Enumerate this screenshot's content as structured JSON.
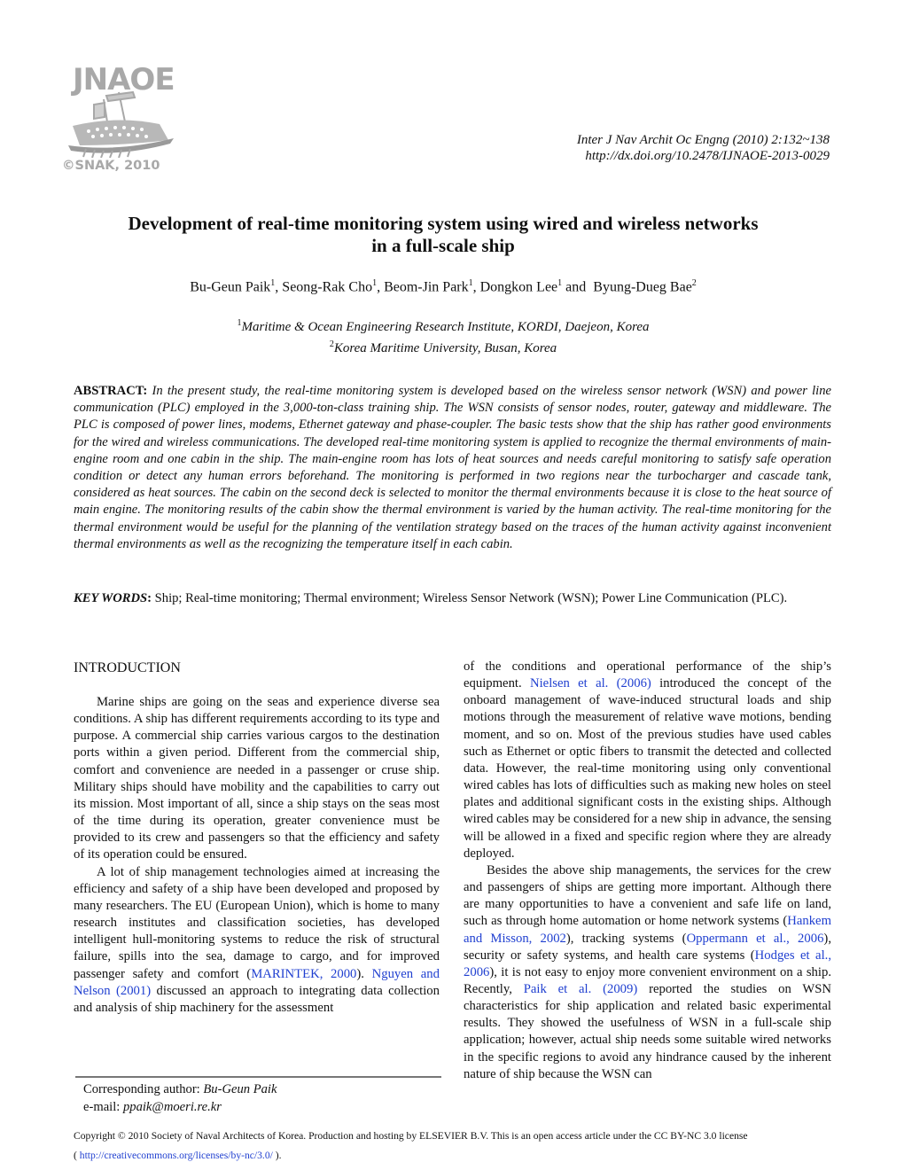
{
  "logo": {
    "name": "JNAOE",
    "copyright": "©SNAK, 2010",
    "icon": "ship-logo-icon"
  },
  "journal_ref": {
    "citation": "Inter J Nav Archit Oc Engng (2010) 2:132~138",
    "doi": "http://dx.doi.org/10.2478/IJNAOE-2013-0029"
  },
  "paper": {
    "title_line1": "Development of real-time monitoring system using wired and wireless networks",
    "title_line2": "in a full-scale ship",
    "authors": [
      {
        "name": "Bu-Geun Paik",
        "aff": "1",
        "sep": ", "
      },
      {
        "name": "Seong-Rak Cho",
        "aff": "1",
        "sep": ", "
      },
      {
        "name": "Beom-Jin Park",
        "aff": "1",
        "sep": ", "
      },
      {
        "name": "Dongkon Lee",
        "aff": "1",
        "sep": " and  "
      },
      {
        "name": "Byung-Dueg Bae",
        "aff": "2",
        "sep": ""
      }
    ],
    "affiliations": [
      {
        "num": "1",
        "text": "Maritime & Ocean Engineering Research Institute, KORDI, Daejeon, Korea"
      },
      {
        "num": "2",
        "text": "Korea Maritime University, Busan, Korea"
      }
    ]
  },
  "abstract": {
    "label": "ABSTRACT:",
    "text": "In the present study, the real-time monitoring system is developed based on the wireless sensor network (WSN) and power line communication (PLC) employed in the 3,000-ton-class training ship. The WSN consists of sensor nodes, router, gateway and middleware. The PLC is composed of power lines, modems, Ethernet gateway and phase-coupler. The basic tests show that the ship has rather good environments for the wired and wireless communications. The developed real-time monitoring system is applied to recognize the thermal environments of main-engine room and one cabin in the ship. The main-engine room has lots of heat sources and needs careful monitoring to satisfy safe operation condition or detect any human errors beforehand. The monitoring is performed in two regions near the turbocharger and cascade tank, considered as heat sources. The cabin on the second deck is selected to monitor the thermal environments because it is close to the heat source of main engine. The monitoring results of the cabin show the thermal environment is varied by the human activity. The real-time monitoring for the thermal environment would be useful for the planning of the ventilation strategy based on the traces of the human activity against inconvenient thermal environments as well as the recognizing the temperature itself in each cabin."
  },
  "keywords": {
    "label": "KEY WORDS",
    "colon": ":",
    "text": "Ship; Real-time monitoring; Thermal environment; Wireless Sensor Network (WSN); Power Line Communication (PLC)."
  },
  "introduction": {
    "heading": "INTRODUCTION",
    "p1": "Marine ships are going on the seas and experience diverse sea conditions. A ship has different requirements according to its type and purpose. A commercial ship carries various cargos to the destination ports within a given period. Different from the commercial ship, comfort and convenience are needed in a passenger or cruse ship. Military ships should have mobility and the capabilities to carry out its mission. Most important of all, since a ship stays on the seas most of the time during its operation, greater convenience must be provided to its crew and passengers so that the efficiency and safety of its operation could be ensured.",
    "p2_a": "A lot of ship management technologies aimed at increasing the efficiency and safety of a ship have been developed and proposed by many researchers. The EU (European Union), which is home to many research institutes and classification societies, has developed intelligent hull-monitoring systems to reduce the risk of structural failure, spills into the sea, damage to cargo, and for improved passenger safety and comfort (",
    "p2_link1": "MARINTEK, 2000",
    "p2_b": "). ",
    "p2_link2": "Nguyen and Nelson (2001)",
    "p2_c": " discussed an approach to integrating data collection and analysis of ship machinery for the assessment",
    "r1_a": "of the conditions and operational performance of the ship’s equipment. ",
    "r1_link1": "Nielsen et al. (2006)",
    "r1_b": " introduced the concept of the onboard management of wave-induced structural loads and ship motions through the measurement of relative wave motions, bending moment, and so on. Most of the previous studies have used cables such as Ethernet or optic fibers to transmit the detected and collected data. However, the real-time monitoring using only conventional wired cables has lots of difficulties such as making new holes on steel plates and additional significant costs in the existing ships. Although wired cables may be considered for a new ship in advance, the sensing will be allowed in a fixed and specific region where they are already deployed.",
    "r2_a": "Besides the above ship managements, the services for the crew and passengers of ships are getting more important. Although there are many opportunities to have a convenient and safe life on land, such as through home automation or home network systems (",
    "r2_link1": "Hankem and Misson, 2002",
    "r2_b": "), tracking systems (",
    "r2_link2": "Oppermann et al., 2006",
    "r2_c": "), security or safety systems, and health care systems (",
    "r2_link3": "Hodges et al., 2006",
    "r2_d": "), it is not easy to enjoy more convenient environment on a ship. Recently, ",
    "r2_link4": "Paik et al. (2009)",
    "r2_e": " reported the studies on WSN characteristics for ship application and related basic experimental results. They showed the usefulness of WSN in a full-scale ship application; however, actual ship needs some suitable wired networks in the specific regions to avoid any hindrance caused by the inherent nature of ship because the WSN can"
  },
  "footnote": {
    "author_label": "Corresponding author: ",
    "author_name": "Bu-Geun Paik",
    "email_label": "e-mail: ",
    "email": "ppaik@moeri.re.kr"
  },
  "copyright": {
    "text": "Copyright © 2010 Society of Naval Architects of Korea. Production and  hosting by ELSEVIER B.V. This is an open access article under the CC BY-NC 3.0 license",
    "open": "( ",
    "license_url": "http://creativecommons.org/licenses/by-nc/3.0/",
    "close": " )."
  },
  "colors": {
    "link": "#1f3fd0",
    "logo_gray": "#a8a8a8"
  }
}
